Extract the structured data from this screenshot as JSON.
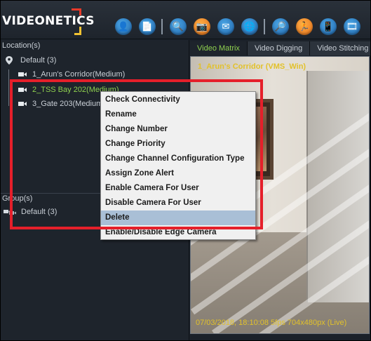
{
  "app": {
    "logo_text": "VIDEONETICS",
    "colors": {
      "bg": "#1b2129",
      "accent_green": "#8fd14f",
      "overlay_yellow": "#e2c12a",
      "annotation_red": "#e51f2a",
      "menu_highlight": "#a9bfd6"
    }
  },
  "toolbar": {
    "icons": [
      {
        "name": "user-icon",
        "glyph": "👤",
        "color": "blue"
      },
      {
        "name": "report-icon",
        "glyph": "📄",
        "color": "blue"
      },
      {
        "name": "separator"
      },
      {
        "name": "camera-search-icon",
        "glyph": "🔍",
        "color": "blue"
      },
      {
        "name": "snapshot-icon",
        "glyph": "📷",
        "color": "orange"
      },
      {
        "name": "mail-icon",
        "glyph": "✉",
        "color": "blue"
      },
      {
        "name": "globe-icon",
        "glyph": "🌐",
        "color": "blue"
      },
      {
        "name": "separator"
      },
      {
        "name": "search-icon",
        "glyph": "🔎",
        "color": "blue"
      },
      {
        "name": "running-man-icon",
        "glyph": "🏃",
        "color": "orange"
      },
      {
        "name": "mobile-icon",
        "glyph": "📱",
        "color": "blue"
      },
      {
        "name": "video-reel-icon",
        "glyph": "🎞",
        "color": "blue"
      }
    ]
  },
  "left_panel": {
    "locations_label": "Location(s)",
    "locations_root": "Default (3)",
    "cameras": [
      {
        "label": "1_Arun's Corridor(Medium)",
        "selected": false
      },
      {
        "label": "2_TSS Bay 202(Medium)",
        "selected": true
      },
      {
        "label": "3_Gate 203(Medium)",
        "selected": false
      }
    ],
    "groups_label": "Group(s)",
    "groups_root": "Default (3)"
  },
  "tabs": [
    {
      "label": "Video Matrix",
      "active": true
    },
    {
      "label": "Video Digging",
      "active": false
    },
    {
      "label": "Video Stitching",
      "active": false
    }
  ],
  "video": {
    "title": "1_Arun's Corridor (VMS_Win)",
    "stamp": "07/03/2018, 18:10:08  5fps  704x480px  (Live)"
  },
  "context_menu": {
    "items": [
      {
        "label": "Check Connectivity",
        "highlighted": false
      },
      {
        "label": "Rename",
        "highlighted": false
      },
      {
        "label": "Change Number",
        "highlighted": false
      },
      {
        "label": "Change Priority",
        "highlighted": false
      },
      {
        "label": "Change Channel Configuration Type",
        "highlighted": false
      },
      {
        "label": "Assign Zone Alert",
        "highlighted": false
      },
      {
        "label": "Enable Camera For User",
        "highlighted": false
      },
      {
        "label": "Disable Camera For User",
        "highlighted": false
      },
      {
        "label": "Delete",
        "highlighted": true
      },
      {
        "label": "Enable/Disable Edge Camera",
        "highlighted": false
      }
    ]
  }
}
